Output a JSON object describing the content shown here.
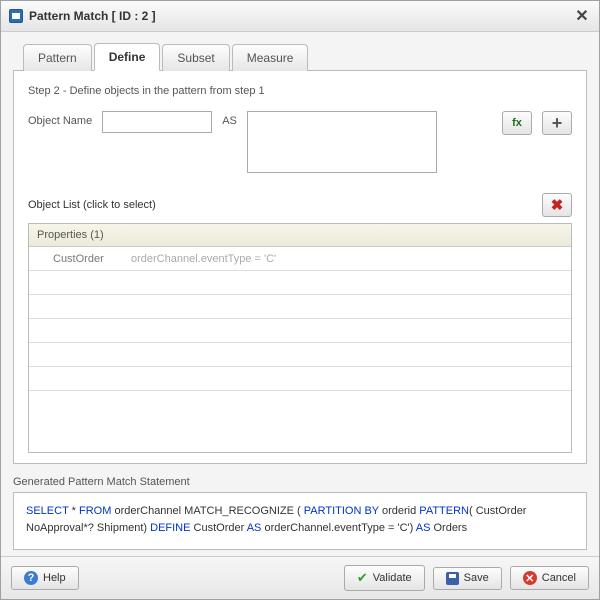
{
  "titlebar": {
    "title": "Pattern Match [ ID : 2 ]"
  },
  "tabs": {
    "pattern": "Pattern",
    "define": "Define",
    "subset": "Subset",
    "measure": "Measure"
  },
  "step_label": "Step 2 - Define objects in the pattern from step 1",
  "object_name_label": "Object Name",
  "object_name_value": "",
  "as_label": "AS",
  "as_value": "",
  "object_list_label": "Object List (click to select)",
  "table": {
    "header": "Properties (1)",
    "rows": [
      {
        "name": "CustOrder",
        "expr": "orderChannel.eventType = 'C'"
      }
    ]
  },
  "generated_label": "Generated Pattern Match Statement",
  "generated": {
    "tokens": [
      {
        "t": "SELECT",
        "k": true
      },
      {
        "t": " * "
      },
      {
        "t": "FROM",
        "k": true
      },
      {
        "t": " orderChannel  MATCH_RECOGNIZE ( "
      },
      {
        "t": "PARTITION BY",
        "k": true
      },
      {
        "t": " orderid "
      },
      {
        "t": "PATTERN",
        "k": true
      },
      {
        "t": "( CustOrder NoApproval*? Shipment) "
      },
      {
        "t": "DEFINE",
        "k": true
      },
      {
        "t": " CustOrder "
      },
      {
        "t": "AS",
        "k": true
      },
      {
        "t": " orderChannel.eventType =  'C') "
      },
      {
        "t": "AS",
        "k": true
      },
      {
        "t": " Orders"
      }
    ]
  },
  "buttons": {
    "help": "Help",
    "validate": "Validate",
    "save": "Save",
    "cancel": "Cancel",
    "fx": "fx",
    "plus": "+",
    "delete": "✖"
  }
}
